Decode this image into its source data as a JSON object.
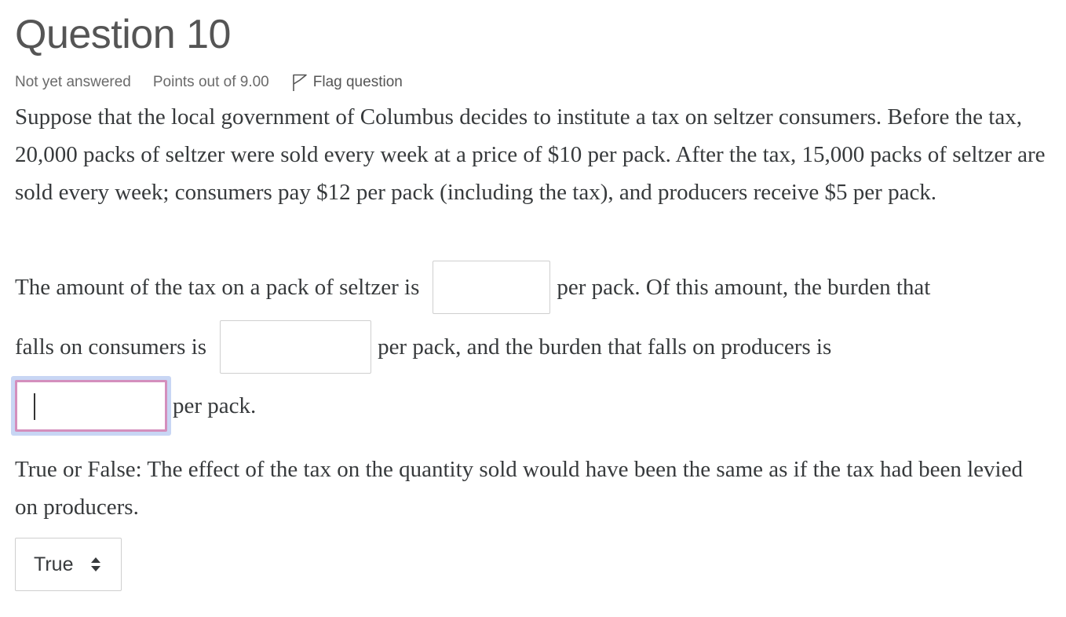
{
  "question": {
    "title": "Question 10",
    "state": "Not yet answered",
    "grade": "Points out of 9.00",
    "flag_label": "Flag question",
    "text": "Suppose that the local government of Columbus decides to institute a tax on seltzer consumers. Before the tax, 20,000 packs of seltzer were sold every week at a price of $10 per pack. After the tax, 15,000 packs of seltzer are sold every week; consumers pay $12 per pack (including the tax), and producers receive $5 per pack."
  },
  "fill_in": {
    "line1_before": "The amount of the tax on a pack of seltzer is",
    "line1_after": "per pack. Of this amount, the burden that",
    "line2_before": "falls on consumers is",
    "line2_after": "per pack, and the burden that falls on producers is",
    "line3_after": "per pack.",
    "tax_amount_value": "",
    "consumer_burden_value": "",
    "producer_burden_value": ""
  },
  "true_false": {
    "text": "True or False: The effect of the tax on the quantity sold would have been the same as if the tax had been levied on producers.",
    "selected": "True"
  },
  "icons": {
    "flag": "flag-icon",
    "select_arrows": "sort-arrows-icon"
  },
  "colors": {
    "focus_ring": "#c8d6f4",
    "focus_border": "#d48fbd",
    "title": "#555555",
    "text": "#373a3c"
  }
}
